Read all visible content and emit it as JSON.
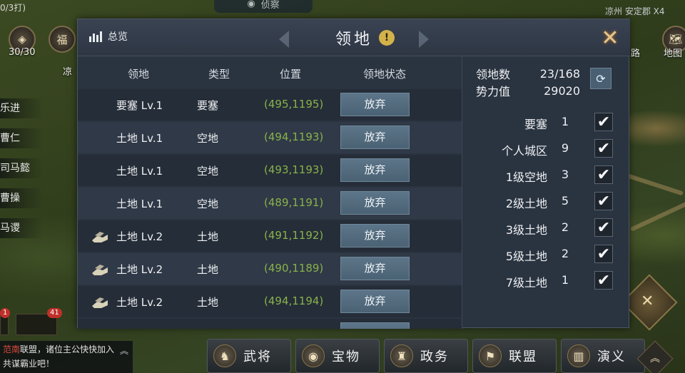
{
  "background": {
    "top_left_text": "0/3打)",
    "top_pill_label": "侦察",
    "top_right_text": "凉州 安定郡 X4",
    "top_icons": [
      {
        "glyph": "◈",
        "label": "30/30"
      },
      {
        "glyph": "福",
        "label": "凉"
      }
    ],
    "right_icon_label": "地图",
    "right_icon_partial": "路",
    "left_names": [
      "乐进",
      "曹仁",
      "司马懿",
      "曹操",
      "马谡"
    ],
    "badges": [
      "1",
      "41"
    ],
    "chat": {
      "highlight": "范南",
      "line1": "联盟，诸位主公快快加入",
      "line2": "共谋霸业吧！",
      "up_glyph": "︽"
    },
    "bottom_buttons": [
      {
        "label": "武将",
        "glyph": "♞"
      },
      {
        "label": "宝物",
        "glyph": "◉"
      },
      {
        "label": "政务",
        "glyph": "♜"
      },
      {
        "label": "联盟",
        "glyph": "⚑"
      },
      {
        "label": "演义",
        "glyph": "▥"
      }
    ],
    "corner_up_glyph": "︽",
    "corner_x_glyph": "✕"
  },
  "modal": {
    "overview_label": "总览",
    "title": "领地",
    "info_glyph": "!",
    "close_glyph": "✕",
    "columns": [
      "领地",
      "类型",
      "位置",
      "领地状态"
    ],
    "rows": [
      {
        "name": "要塞 Lv.1",
        "type": "要塞",
        "pos": "(495,1195)",
        "action": "放弃",
        "icon": ""
      },
      {
        "name": "土地 Lv.1",
        "type": "空地",
        "pos": "(494,1193)",
        "action": "放弃",
        "icon": ""
      },
      {
        "name": "土地 Lv.1",
        "type": "空地",
        "pos": "(493,1193)",
        "action": "放弃",
        "icon": ""
      },
      {
        "name": "土地 Lv.1",
        "type": "空地",
        "pos": "(489,1191)",
        "action": "放弃",
        "icon": ""
      },
      {
        "name": "土地 Lv.2",
        "type": "土地",
        "pos": "(491,1192)",
        "action": "放弃",
        "icon": "stone-resource-icon"
      },
      {
        "name": "土地 Lv.2",
        "type": "土地",
        "pos": "(490,1189)",
        "action": "放弃",
        "icon": "stone-resource-icon"
      },
      {
        "name": "土地 Lv.2",
        "type": "土地",
        "pos": "(494,1194)",
        "action": "放弃",
        "icon": "stone-resource-icon"
      }
    ],
    "stats": {
      "territory_label": "领地数",
      "territory_value": "23/168",
      "power_label": "势力值",
      "power_value": "29020",
      "refresh_glyph": "⟳"
    },
    "filters": [
      {
        "label": "要塞",
        "count": "1",
        "checked": true
      },
      {
        "label": "个人城区",
        "count": "9",
        "checked": true
      },
      {
        "label": "1级空地",
        "count": "3",
        "checked": true
      },
      {
        "label": "2级土地",
        "count": "5",
        "checked": true
      },
      {
        "label": "3级土地",
        "count": "2",
        "checked": true
      },
      {
        "label": "5级土地",
        "count": "2",
        "checked": true
      },
      {
        "label": "7级土地",
        "count": "1",
        "checked": true
      }
    ],
    "check_glyph": "✔"
  },
  "colors": {
    "modal_bg": "#2a3340",
    "position_text": "#88b24a",
    "abandon_button": "#4a6274",
    "info_icon": "#d4b24a",
    "close_icon": "#e6c48a"
  }
}
